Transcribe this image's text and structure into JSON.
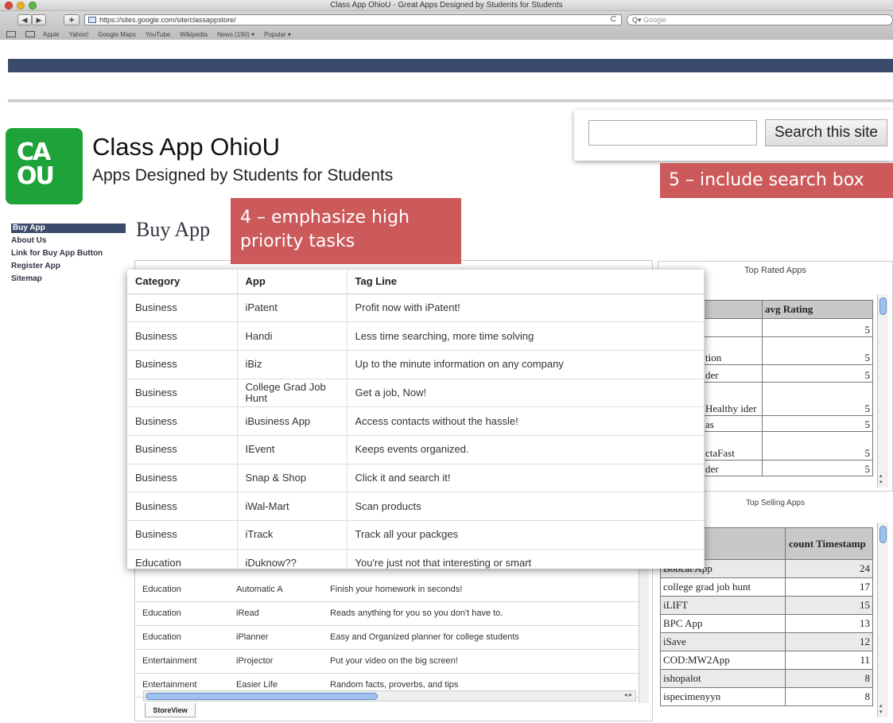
{
  "browser": {
    "window_title": "Class App OhioU - Great Apps Designed by Students for Students",
    "url": "https://sites.google.com/site/classappstore/",
    "search_placeholder": "Google",
    "nav_back": "◀",
    "nav_forward": "▶",
    "add_label": "+",
    "reload_glyph": "C",
    "bookmarks": [
      "Apple",
      "Yahoo!",
      "Google Maps",
      "YouTube",
      "Wikipedia",
      "News (190) ▾",
      "Popular ▾"
    ]
  },
  "site": {
    "logo_text": "CA OU",
    "title": "Class App OhioU",
    "subtitle": "Apps Designed by Students for Students",
    "search_button": "Search this site",
    "search_value": ""
  },
  "annotations": {
    "callout_5": "5 – include search box",
    "callout_4": "4 – emphasize high priority tasks"
  },
  "sidebar": {
    "items": [
      {
        "label": "Buy App",
        "active": true
      },
      {
        "label": "About Us"
      },
      {
        "label": "Link for Buy App Button"
      },
      {
        "label": "Register App"
      },
      {
        "label": "Sitemap"
      }
    ]
  },
  "page": {
    "heading": "Buy App"
  },
  "overlay_table": {
    "headers": [
      "Category",
      "App",
      "Tag Line"
    ],
    "rows": [
      [
        "Business",
        "iPatent",
        "Profit now with iPatent!"
      ],
      [
        "Business",
        "Handi",
        "Less time searching, more time solving"
      ],
      [
        "Business",
        "iBiz",
        "Up to the minute information on any company"
      ],
      [
        "Business",
        "College Grad Job Hunt",
        "Get a job, Now!"
      ],
      [
        "Business",
        "iBusiness App",
        "Access contacts without the hassle!"
      ],
      [
        "Business",
        "IEvent",
        "Keeps events organized."
      ],
      [
        "Business",
        "Snap & Shop",
        "Click it and search it!"
      ],
      [
        "Business",
        "iWal-Mart",
        "Scan products"
      ],
      [
        "Business",
        "iTrack",
        "Track all your packges"
      ],
      [
        "Education",
        "iDuknow??",
        "You're just not that interesting or smart"
      ]
    ]
  },
  "under_table": {
    "rows": [
      [
        "Education",
        "Automatic A",
        "Finish your homework in seconds!"
      ],
      [
        "Education",
        "iRead",
        "Reads anything for you so you don't have to."
      ],
      [
        "Education",
        "iPlanner",
        "Easy and Organized planner for college students"
      ],
      [
        "Entertainment",
        "iProjector",
        "Put your video on the big screen!"
      ],
      [
        "Entertainment",
        "Easier Life",
        "Random facts, proverbs, and tips"
      ]
    ],
    "tab_label": "StoreView"
  },
  "top_rated": {
    "title": "Top Rated Apps",
    "col_rating": "avg Rating",
    "rows": [
      {
        "label": "",
        "value": "5"
      },
      {
        "label": "tion",
        "value": "5"
      },
      {
        "label": "der",
        "value": "5"
      },
      {
        "label": "Healthy ider",
        "value": "5"
      },
      {
        "label": "as",
        "value": "5"
      },
      {
        "label": "ctaFast",
        "value": "5"
      },
      {
        "label": "der",
        "value": "5"
      }
    ]
  },
  "top_selling": {
    "title": "Top Selling Apps",
    "col_count": "count Timestamp",
    "rows": [
      {
        "label": "Bobcat App",
        "value": "24"
      },
      {
        "label": "college grad job hunt",
        "value": "17"
      },
      {
        "label": "iLIFT",
        "value": "15"
      },
      {
        "label": "BPC App",
        "value": "13"
      },
      {
        "label": "iSave",
        "value": "12"
      },
      {
        "label": "COD:MW2App",
        "value": "11"
      },
      {
        "label": "ishopalot",
        "value": "8"
      },
      {
        "label": "ispecimenyyn",
        "value": "8"
      }
    ]
  }
}
